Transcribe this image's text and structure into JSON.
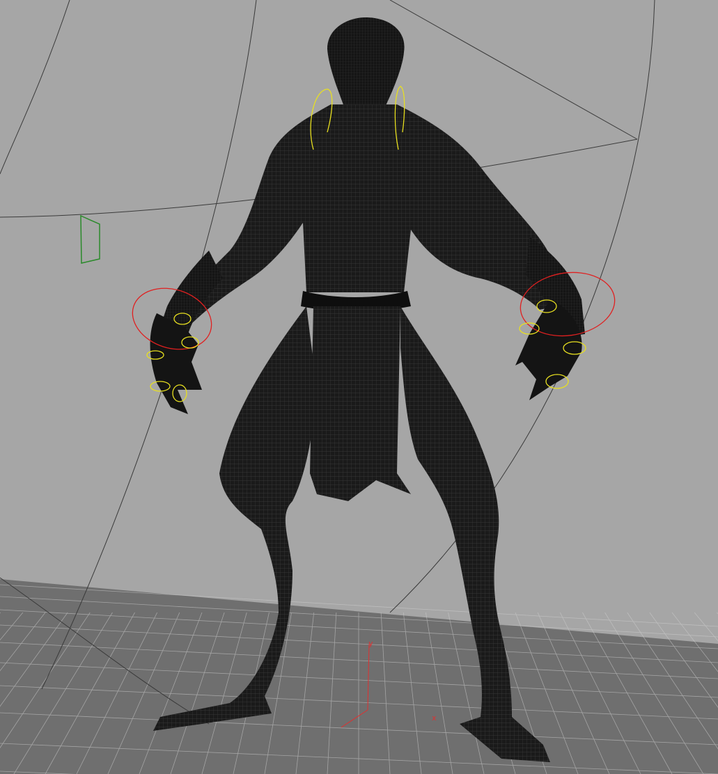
{
  "viewport": {
    "background_color": "#a6a6a6",
    "floor_color": "#6f6f6f",
    "grid_color": "#d0d0d0",
    "mesh_color": "#111111",
    "wireframe_color": "#4a4a4a",
    "curve_color": "#3a3a3a"
  },
  "rig_controls": {
    "fk_ring_color": "#e02020",
    "finger_control_color": "#e8e020",
    "locator_color": "#2a8a2a"
  },
  "origin_axis": {
    "x_label": "x",
    "y_label": "y",
    "color": "#e03030"
  }
}
